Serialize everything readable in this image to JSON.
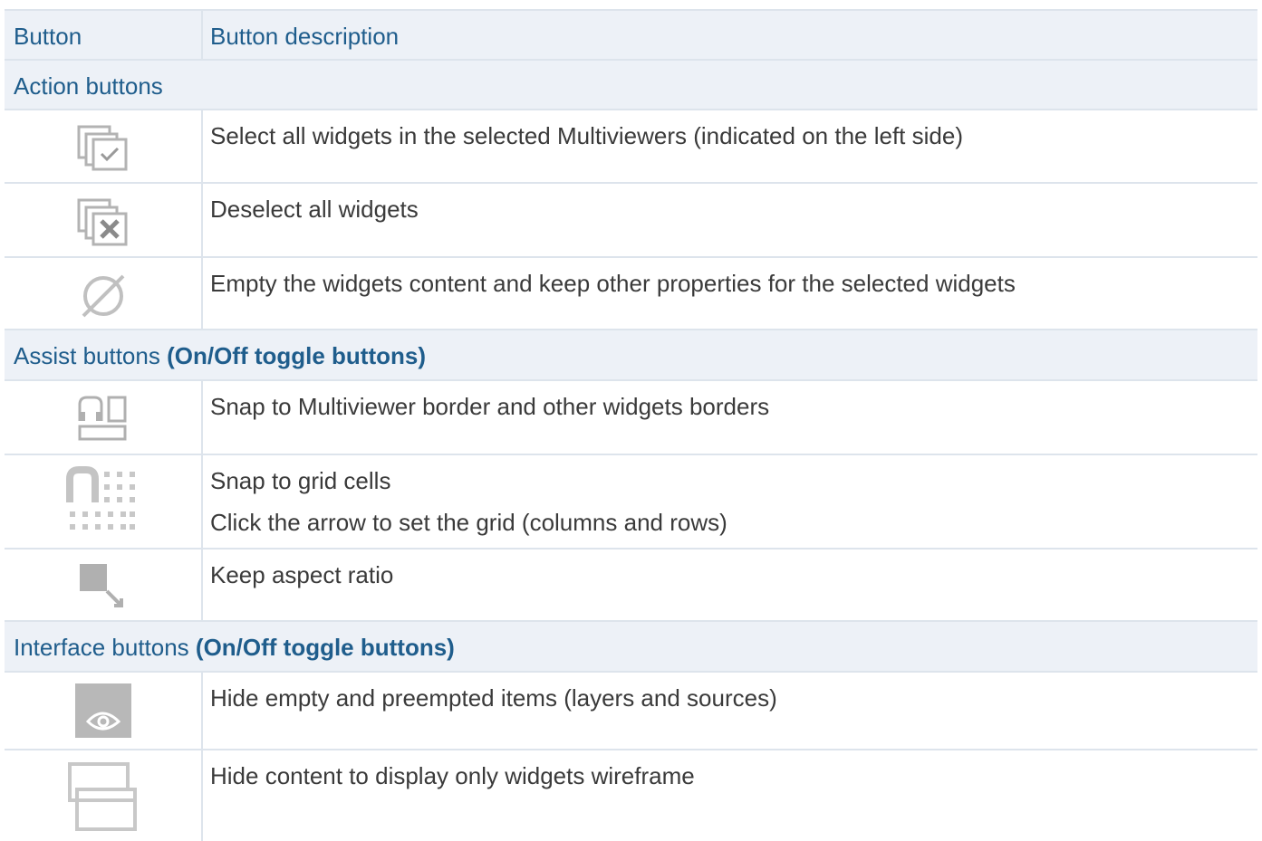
{
  "header": {
    "col1": "Button",
    "col2": "Button description"
  },
  "sections": [
    {
      "title": "Action buttons",
      "title_suffix": "",
      "rows": [
        {
          "icon": "select-all-icon",
          "lines": [
            "Select all widgets in the selected Multiviewers (indicated on the left side)"
          ]
        },
        {
          "icon": "deselect-all-icon",
          "lines": [
            "Deselect all widgets"
          ]
        },
        {
          "icon": "empty-content-icon",
          "lines": [
            "Empty the widgets content and keep other properties for the selected widgets"
          ]
        }
      ]
    },
    {
      "title": "Assist buttons ",
      "title_suffix": "(On/Off toggle buttons)",
      "rows": [
        {
          "icon": "snap-border-icon",
          "lines": [
            "Snap to Multiviewer border and other widgets borders"
          ]
        },
        {
          "icon": "snap-grid-icon",
          "lines": [
            "Snap to grid cells",
            "Click the arrow to set the grid (columns and rows)"
          ]
        },
        {
          "icon": "aspect-ratio-icon",
          "lines": [
            "Keep aspect ratio"
          ]
        }
      ]
    },
    {
      "title": "Interface buttons ",
      "title_suffix": "(On/Off toggle buttons)",
      "rows": [
        {
          "icon": "eye-icon",
          "lines": [
            "Hide empty and preempted items (layers and sources)"
          ]
        },
        {
          "icon": "wireframe-icon",
          "lines": [
            "Hide content to display only widgets wireframe"
          ]
        }
      ]
    }
  ]
}
